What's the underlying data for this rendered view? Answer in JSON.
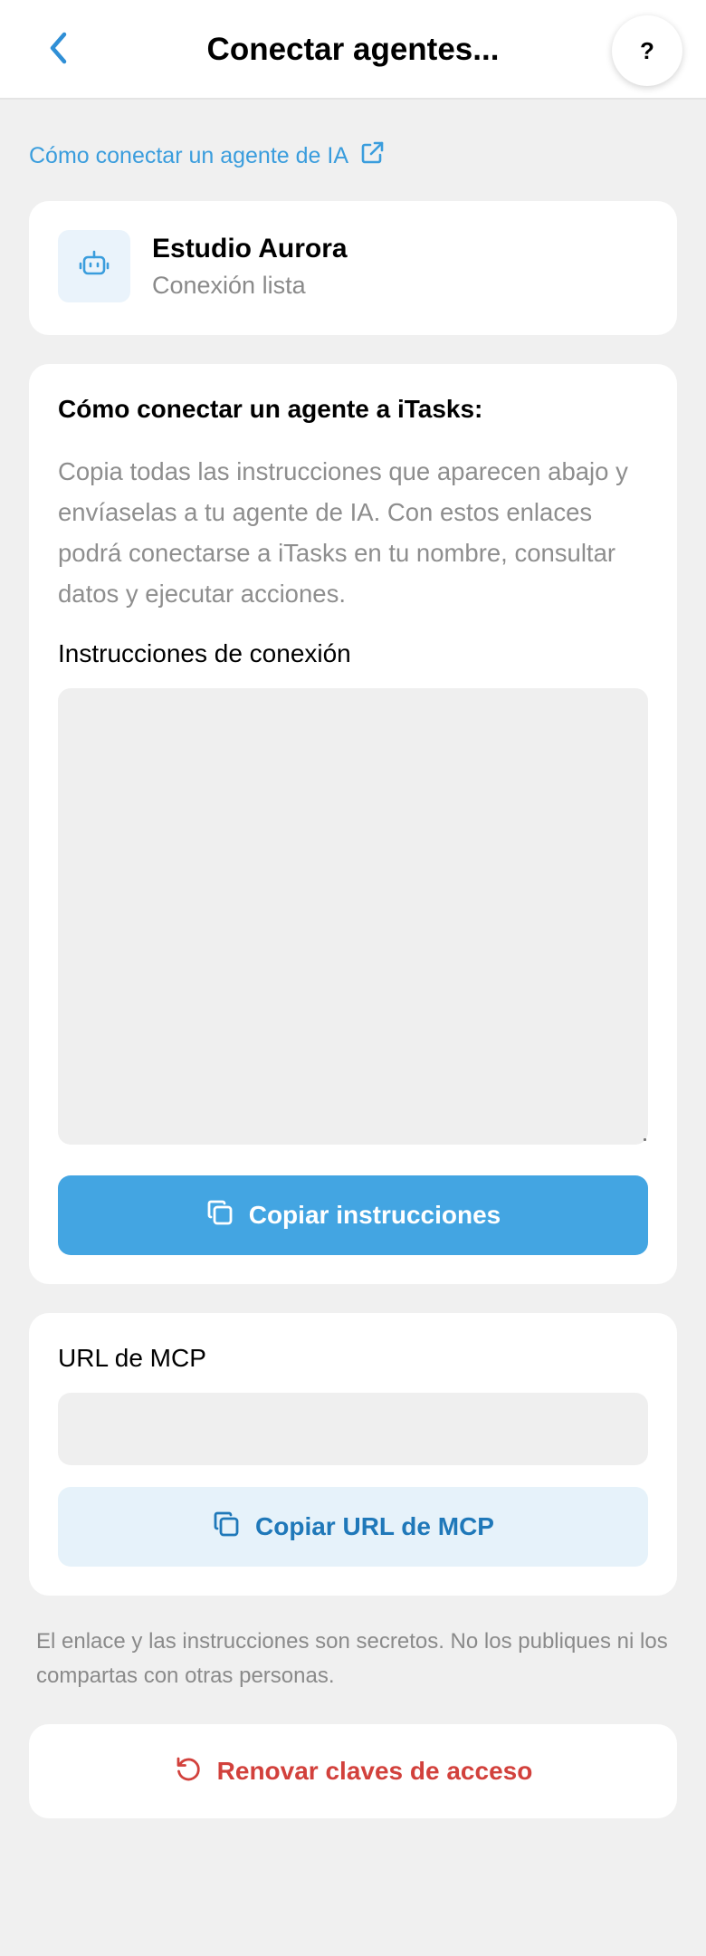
{
  "header": {
    "back_icon": "chevron-left-icon",
    "title": "Conectar agentes...",
    "help_label": "?"
  },
  "guide_link": {
    "label": "Cómo conectar un agente de IA",
    "icon": "external-link-icon"
  },
  "agent": {
    "icon": "robot-icon",
    "name": "Estudio Aurora",
    "status": "Conexión lista"
  },
  "instructions": {
    "title": "Cómo conectar un agente a iTasks:",
    "description": "Copia todas las instrucciones que aparecen abajo y envíaselas a tu agente de IA. Con estos enlaces podrá conectarse a iTasks en tu nombre, consultar datos y ejecutar acciones.",
    "field_label": "Instrucciones de conexión",
    "field_value": "",
    "copy_button": "Copiar instrucciones",
    "copy_icon": "copy-icon"
  },
  "mcp": {
    "label": "URL de MCP",
    "value": "",
    "copy_button": "Copiar URL de MCP",
    "copy_icon": "copy-icon"
  },
  "secret_note": "El enlace y las instrucciones son secretos. No los publiques ni los compartas con otras personas.",
  "renew": {
    "label": "Renovar claves de acceso",
    "icon": "refresh-icon"
  },
  "colors": {
    "accent": "#43a5e2",
    "link": "#3a9ddd",
    "secondary_text": "#1f78b9",
    "danger": "#d2413c",
    "background": "#f0f0f0"
  }
}
